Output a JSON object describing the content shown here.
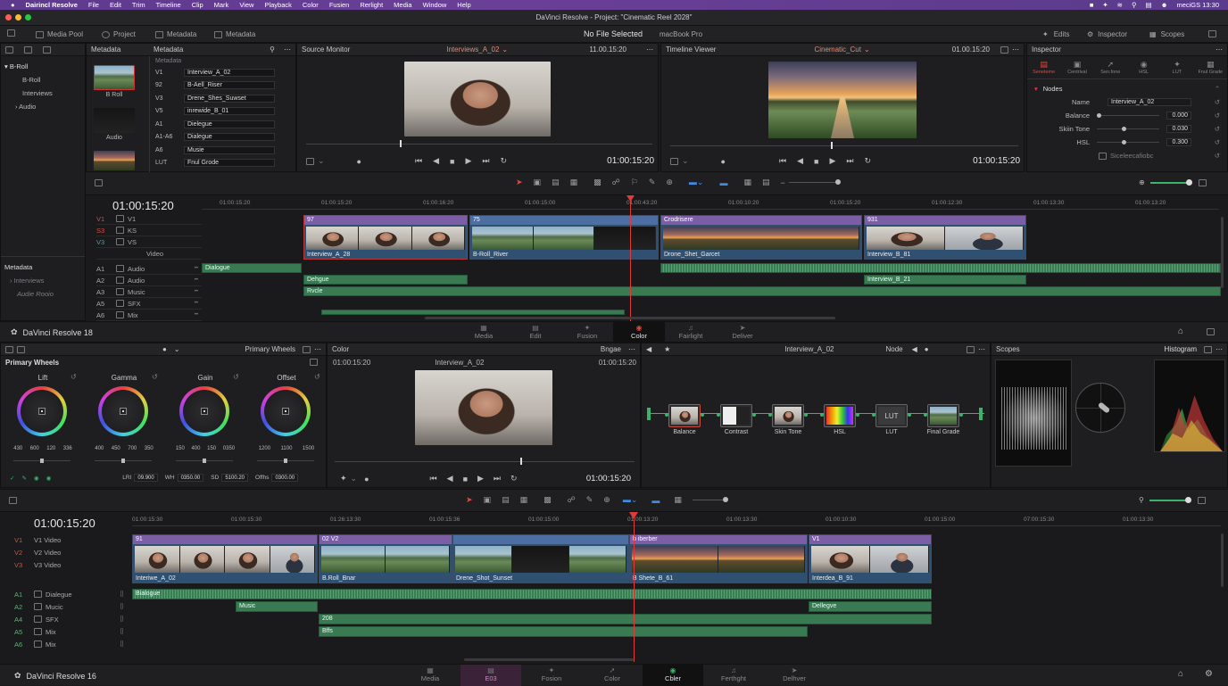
{
  "menubar": {
    "app": "Dairincl Resolve",
    "items": [
      "File",
      "Edit",
      "Trim",
      "Timeline",
      "Clip",
      "Mark",
      "View",
      "Playback",
      "Color",
      "Fusien",
      "Rerlight",
      "Media",
      "Window",
      "Help"
    ],
    "clock": "meciGS 13:30"
  },
  "titlebar": {
    "title": "DaVinci Resolve - Project: \"Cinematic Reel 2028\""
  },
  "toolbar": {
    "media_pool": "Media Pool",
    "project": "Project",
    "metadata": "Metadata",
    "center": "No File Selected",
    "device": "macBook Pro",
    "edits": "Edits",
    "inspector": "Inspector",
    "scopes": "Scopes"
  },
  "bins": {
    "root": "B-Roll",
    "items": [
      "B-Roll",
      "Interviews",
      "Audio"
    ],
    "section": "Metadata",
    "sub": [
      "Interviews",
      "Audie Rooio"
    ]
  },
  "metadata_panel": {
    "title": "Metadata",
    "title2": "Metadata",
    "thumb_labels": [
      "B Roll",
      "Audio"
    ],
    "sub": "Metadata",
    "rows": [
      {
        "k": "V1",
        "v": "Interview_A_02"
      },
      {
        "k": "92",
        "v": "B-Aell_Riser"
      },
      {
        "k": "V3",
        "v": "Drene_Shes_Suwset"
      },
      {
        "k": "V5",
        "v": "inrewide_B_01"
      },
      {
        "k": "A1",
        "v": "Dielegue"
      },
      {
        "k": "A1-A6",
        "v": "Dialegue"
      },
      {
        "k": "A6",
        "v": "Musie"
      },
      {
        "k": "LUT",
        "v": "Fnul Grode"
      }
    ]
  },
  "source_monitor": {
    "title": "Source Monitor",
    "clip": "Interviews_A_02",
    "tc_top": "11.00.15:20",
    "tc": "01:00:15:20"
  },
  "timeline_viewer": {
    "title": "Timeline Viewer",
    "clip": "Cinematic_Cut",
    "tc_top": "01.00.15:20",
    "tc": "01:00:15:20"
  },
  "inspector": {
    "title": "Inspector",
    "tabs": [
      "Seneteme",
      "Centrival",
      "Sen.fone",
      "HSL",
      "LUT",
      "Fnul Grade"
    ],
    "section": "Nodes",
    "name_label": "Name",
    "name_value": "Interview_A_02",
    "params": [
      {
        "k": "Balance",
        "v": "0.000"
      },
      {
        "k": "Skiin Tone",
        "v": "0.030"
      },
      {
        "k": "HSL",
        "v": "0.300"
      }
    ],
    "footer": "Siceleecafiobc"
  },
  "upper_timeline": {
    "tc": "01:00:15:20",
    "ruler": [
      "01:00:15:20",
      "01:00:15:20",
      "01:00:16:20",
      "01:00:15:00",
      "01:00:43:20",
      "01:00:10:20",
      "01:00:15:20",
      "01:00:12:30",
      "01:00:13:30",
      "01:00:13:20"
    ],
    "video_tracks": [
      {
        "id": "V1",
        "name": "V1"
      },
      {
        "id": "S3",
        "name": "KS"
      },
      {
        "id": "V3",
        "name": "VS"
      },
      {
        "id": "",
        "name": "Video"
      }
    ],
    "audio_tracks": [
      {
        "id": "A1",
        "name": "Audio"
      },
      {
        "id": "A2",
        "name": "Audio"
      },
      {
        "id": "A3",
        "name": "Music"
      },
      {
        "id": "A5",
        "name": "SFX"
      },
      {
        "id": "A6",
        "name": "Mix"
      }
    ],
    "clips": [
      {
        "hdr": "97",
        "lbl": "Interview_A_28"
      },
      {
        "hdr": "75",
        "lbl": "B-Roll_River"
      },
      {
        "hdr": "Crodrisere",
        "lbl": "Drone_Shet_Garcet"
      },
      {
        "hdr": "931",
        "lbl": "Interview_B_81"
      }
    ],
    "audio_clips": [
      "Dialogue",
      "Dehgue",
      "Rvcle",
      "Interview_B_21"
    ]
  },
  "pagetabs_top": {
    "app": "DaVinci Resolve 18",
    "tabs": [
      "Media",
      "Edit",
      "Fusion",
      "Color",
      "Fairlight",
      "Deliver"
    ],
    "active": "Color"
  },
  "primary": {
    "title": "Primary Wheels",
    "header": "Primary Wheels",
    "wheels": [
      {
        "name": "Lift",
        "vals": [
          "430",
          "600",
          "120",
          "336"
        ]
      },
      {
        "name": "Gamma",
        "vals": [
          "400",
          "450",
          "700",
          "350"
        ]
      },
      {
        "name": "Gain",
        "vals": [
          "150",
          "400",
          "150",
          "0350"
        ]
      },
      {
        "name": "Offset",
        "vals": [
          "1200",
          "1100",
          "1500"
        ]
      }
    ],
    "bottom": [
      {
        "k": "LRI",
        "v": "09.900"
      },
      {
        "k": "WH",
        "v": "0350.00"
      },
      {
        "k": "SD",
        "v": "5100.20"
      },
      {
        "k": "Offhs",
        "v": "0300.00"
      }
    ]
  },
  "color_viewer": {
    "title": "Color",
    "tc_left": "01:00:15:20",
    "clip": "Interview_A_02",
    "right": "Bngae",
    "tc_right": "01:00:15:20",
    "tc": "01:00:15:20"
  },
  "nodes": {
    "title": "Interview_A_02",
    "label": "Node",
    "items": [
      "Balance",
      "Contrast",
      "Skin Tone",
      "HSL",
      "LUT",
      "Final Grade"
    ]
  },
  "scopes": {
    "title": "Scopes",
    "histogram": "Histogram"
  },
  "lower_timeline": {
    "tc": "01:00:15:20",
    "ruler": [
      "01:00:15:30",
      "01:00:15:30",
      "01:26:13:30",
      "01:00:15:36",
      "01:00:15:00",
      "01:00:13:20",
      "01:00:13:30",
      "01:00:10:30",
      "01:00:15:00",
      "07:00:15:30",
      "01:00:13:30"
    ],
    "video_tracks": [
      {
        "id": "V1",
        "name": "V1 Video"
      },
      {
        "id": "V2",
        "name": "V2 Video"
      },
      {
        "id": "V3",
        "name": "V3 Video"
      }
    ],
    "audio_tracks": [
      {
        "id": "A1",
        "name": "Dialegue"
      },
      {
        "id": "A2",
        "name": "Mucic"
      },
      {
        "id": "A4",
        "name": "SFX"
      },
      {
        "id": "A5",
        "name": "Mix"
      },
      {
        "id": "A6",
        "name": "Mix"
      }
    ],
    "clips": [
      {
        "hdr": "91",
        "lbl": "Interiwe_A_02"
      },
      {
        "hdr": "02 V2",
        "lbl": "B.Roll_Bnar"
      },
      {
        "hdr": "",
        "lbl": "Drene_Shot_Sunset"
      },
      {
        "hdr": "b iberber",
        "lbl": "B Shete_B_61"
      },
      {
        "hdr": "V1",
        "lbl": "Interdea_B_91"
      }
    ],
    "audio_clips": [
      "Bialogue",
      "Music",
      "Dellegve",
      "208",
      "Bffs"
    ]
  },
  "pagetabs_bottom": {
    "app": "DaVinci Resolve 16",
    "tabs": [
      "Media",
      "E03",
      "Fosion",
      "Color",
      "Cbler",
      "Ferthght",
      "Delhver"
    ],
    "active": "Cbler"
  },
  "colors": {
    "accent_red": "#e03a3a",
    "clip_purple": "#7c5ea6",
    "clip_blue": "#4d6ea3",
    "audio_green": "#3a7a52"
  }
}
